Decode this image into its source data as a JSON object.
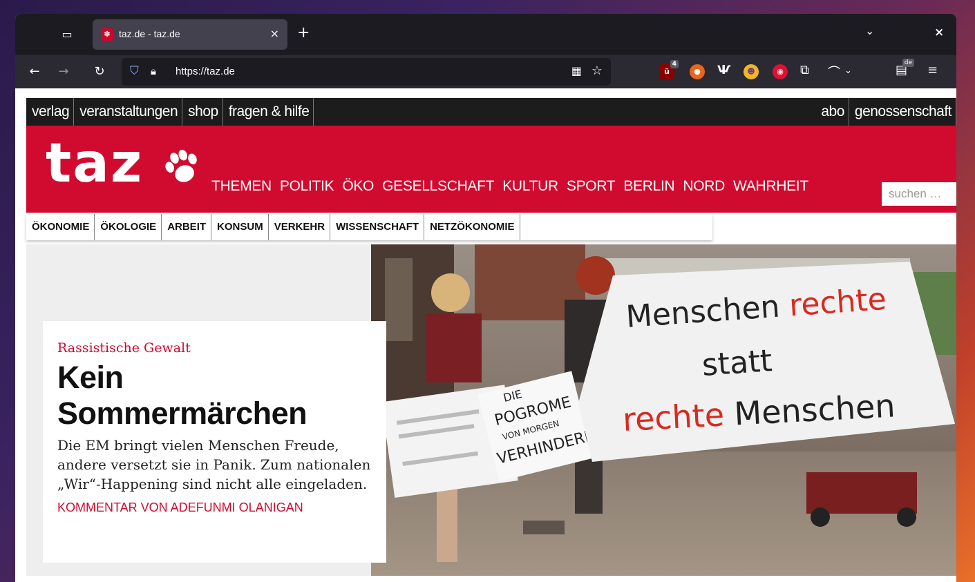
{
  "browser": {
    "tab_title": "taz.de - taz.de",
    "tab_close": "×",
    "new_tab": "+",
    "list_tabs_chevron": "⌄",
    "window_close": "×",
    "url": "https://taz.de",
    "extension_badge_ublock": "4",
    "extension_badge_translate": "de"
  },
  "site": {
    "topnav_left": [
      "verlag",
      "veranstaltungen",
      "shop",
      "fragen & hilfe"
    ],
    "topnav_right": [
      "abo",
      "genossenschaft"
    ],
    "logo": "taz",
    "mainnav": [
      "THEMEN",
      "POLITIK",
      "ÖKO",
      "GESELLSCHAFT",
      "KULTUR",
      "SPORT",
      "BERLIN",
      "NORD",
      "WAHRHEIT"
    ],
    "search_placeholder": "suchen …",
    "subnav": [
      "ÖKONOMIE",
      "ÖKOLOGIE",
      "ARBEIT",
      "KONSUM",
      "VERKEHR",
      "WISSENSCHAFT",
      "NETZÖKONOMIE"
    ],
    "colors": {
      "brand_red": "#d10a2f",
      "topbar": "#1c1c1c"
    }
  },
  "teaser": {
    "kicker": "Rassistische Gewalt",
    "headline_line1": "Kein",
    "headline_line2": "Sommermärchen",
    "lead": "Die EM bringt vielen Menschen Freude, andere versetzt sie in Panik. Zum nationalen „Wir“-Happening sind nicht alle eingeladen.",
    "byline": "KOMMENTAR VON ADEFUNMI OLANIGAN"
  },
  "photo": {
    "banner_line1_a": "Menschen ",
    "banner_line1_b": "rechte",
    "banner_line2": "statt",
    "banner_line3_a": "rechte ",
    "banner_line3_b": "Menschen",
    "sign_line1": "DIE",
    "sign_line2": "POGROME",
    "sign_line3": "VON MORGEN",
    "sign_line4": "VERHINDERN"
  }
}
